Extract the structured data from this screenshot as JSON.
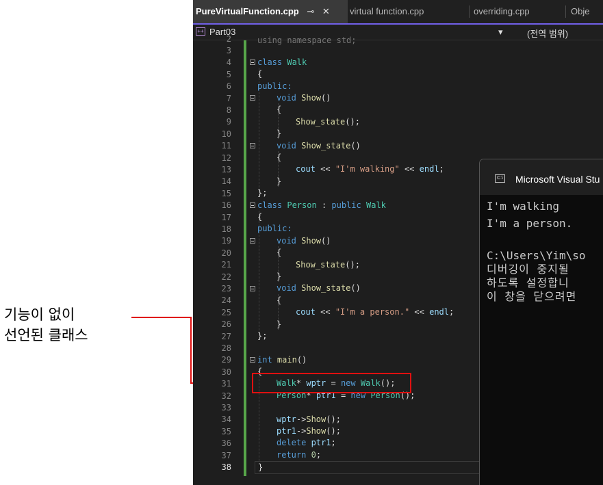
{
  "annotation": {
    "line1": "기능이 없이",
    "line2": "선언된 클래스",
    "color": "#e01010"
  },
  "tabs": [
    {
      "label": "PureVirtualFunction.cpp",
      "active": true,
      "pin": "⊸",
      "close": "✕"
    },
    {
      "label": "virtual function.cpp",
      "active": false
    },
    {
      "label": "overriding.cpp",
      "active": false
    },
    {
      "label": "Obje",
      "active": false
    }
  ],
  "navbar": {
    "project": "Part03",
    "scope_dropdown_arrow": "▾",
    "scope": "(전역 범위)",
    "project_icon": "c++-project-icon"
  },
  "editor": {
    "partial_top_line": "using namespace std;",
    "line_numbers": [
      "2",
      "3",
      "4",
      "5",
      "6",
      "7",
      "8",
      "9",
      "10",
      "11",
      "12",
      "13",
      "14",
      "15",
      "16",
      "17",
      "18",
      "19",
      "20",
      "21",
      "22",
      "23",
      "24",
      "25",
      "26",
      "27",
      "28",
      "29",
      "30",
      "31",
      "32",
      "33",
      "34",
      "35",
      "36",
      "37",
      "38"
    ],
    "current_line": "38",
    "lines": {
      "l4": [
        "class",
        "Walk"
      ],
      "l5": "{",
      "l6": "public:",
      "l7": [
        "void",
        "Show",
        "()"
      ],
      "l8": "{",
      "l9": [
        "Show_state",
        "();"
      ],
      "l10": "}",
      "l11": [
        "void",
        "Show_state",
        "()"
      ],
      "l12": "{",
      "l13": [
        "cout",
        " << ",
        "\"I'm walking\"",
        " << ",
        "endl",
        ";"
      ],
      "l14": "}",
      "l15": "};",
      "l16": [
        "class",
        "Person",
        " : ",
        "public",
        "Walk"
      ],
      "l17": "{",
      "l18": "public:",
      "l19": [
        "void",
        "Show",
        "()"
      ],
      "l20": "{",
      "l21": [
        "Show_state",
        "();"
      ],
      "l22": "}",
      "l23": [
        "void",
        "Show_state",
        "()"
      ],
      "l24": "{",
      "l25": [
        "cout",
        " << ",
        "\"I'm a person.\"",
        " << ",
        "endl",
        ";"
      ],
      "l26": "}",
      "l27": "};",
      "l29": [
        "int",
        "main",
        "()"
      ],
      "l30": "{",
      "l31": [
        "Walk",
        "* ",
        "wptr",
        " = ",
        "new",
        "Walk",
        "();"
      ],
      "l32": [
        "Person",
        "* ",
        "ptr1",
        " = ",
        "new",
        "Person",
        "();"
      ],
      "l34": [
        "wptr",
        "->",
        "Show",
        "();"
      ],
      "l35": [
        "ptr1",
        "->",
        "Show",
        "();"
      ],
      "l36": [
        "delete",
        "ptr1",
        ";"
      ],
      "l37": [
        "return",
        "0",
        ";"
      ],
      "l38": "}"
    }
  },
  "console": {
    "title": "Microsoft Visual Stu",
    "lines": [
      "I'm walking",
      "I'm a person.",
      "",
      "C:\\Users\\Yim\\so",
      "디버깅이 중지될",
      "하도록 설정합니",
      "이 창을 닫으려면"
    ]
  },
  "colors": {
    "keyword": "#569cd6",
    "type": "#4ec9b0",
    "function": "#dcdcaa",
    "string": "#d69d85",
    "identifier": "#9cdcfe",
    "change_bar": "#57a64a",
    "editor_bg": "#1e1e1e"
  }
}
